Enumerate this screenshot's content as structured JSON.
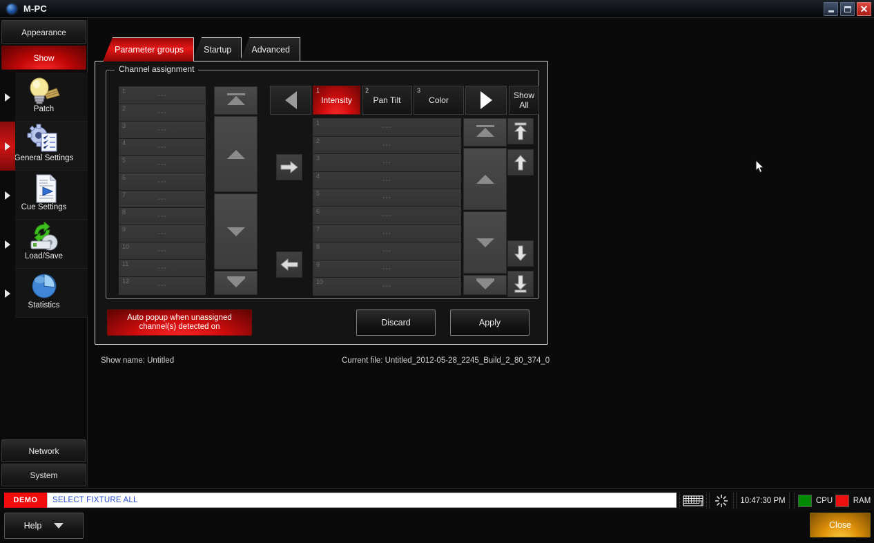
{
  "window": {
    "title": "M-PC",
    "minimize_label": "Minimize",
    "maximize_label": "Maximize",
    "close_label": "Close"
  },
  "sidebar": {
    "top_buttons": [
      {
        "label": "Appearance",
        "active": false
      },
      {
        "label": "Show",
        "active": true
      }
    ],
    "nav_items": [
      {
        "label": "Patch",
        "icon": "lightbulb-icon",
        "selected": false
      },
      {
        "label": "General Settings",
        "icon": "gear-checklist-icon",
        "selected": true
      },
      {
        "label": "Cue Settings",
        "icon": "document-play-icon",
        "selected": false
      },
      {
        "label": "Load/Save",
        "icon": "disk-arrows-icon",
        "selected": false
      },
      {
        "label": "Statistics",
        "icon": "pie-chart-icon",
        "selected": false
      }
    ],
    "bottom_buttons": [
      {
        "label": "Network"
      },
      {
        "label": "System"
      }
    ]
  },
  "tabs": [
    {
      "label": "Parameter groups",
      "active": true
    },
    {
      "label": "Startup",
      "active": false
    },
    {
      "label": "Advanced",
      "active": false
    }
  ],
  "dialog": {
    "groupbox_title": "Channel assignment",
    "left_list": {
      "rows": [
        {
          "index": "1",
          "value": "---"
        },
        {
          "index": "2",
          "value": "---"
        },
        {
          "index": "3",
          "value": "---"
        },
        {
          "index": "4",
          "value": "---"
        },
        {
          "index": "5",
          "value": "---"
        },
        {
          "index": "6",
          "value": "---"
        },
        {
          "index": "7",
          "value": "---"
        },
        {
          "index": "8",
          "value": "---"
        },
        {
          "index": "9",
          "value": "---"
        },
        {
          "index": "10",
          "value": "---"
        },
        {
          "index": "11",
          "value": "---"
        },
        {
          "index": "12",
          "value": "---"
        }
      ]
    },
    "right_list": {
      "rows": [
        {
          "index": "1",
          "value": "---"
        },
        {
          "index": "2",
          "value": "---"
        },
        {
          "index": "3",
          "value": "---"
        },
        {
          "index": "4",
          "value": "---"
        },
        {
          "index": "5",
          "value": "---"
        },
        {
          "index": "6",
          "value": "---"
        },
        {
          "index": "7",
          "value": "---"
        },
        {
          "index": "8",
          "value": "---"
        },
        {
          "index": "9",
          "value": "---"
        },
        {
          "index": "10",
          "value": "---"
        }
      ]
    },
    "parameter_groups": [
      {
        "index": "1",
        "label": "Intensity",
        "active": true
      },
      {
        "index": "2",
        "label": "Pan Tilt",
        "active": false
      },
      {
        "index": "3",
        "label": "Color",
        "active": false
      }
    ],
    "show_all_label": "Show\nAll",
    "show_all_line1": "Show",
    "show_all_line2": "All",
    "auto_popup_line1": "Auto popup when unassigned",
    "auto_popup_line2": "channel(s) detected on",
    "discard_label": "Discard",
    "apply_label": "Apply"
  },
  "footer": {
    "show_name": "Show name: Untitled",
    "current_file": "Current file: Untitled_2012-05-28_2245_Build_2_80_374_0"
  },
  "statusbar": {
    "demo_badge": "DEMO",
    "command_line": "SELECT FIXTURE ALL",
    "keyboard_icon": "keyboard-icon",
    "busy_icon": "starburst-icon",
    "time": "10:47:30 PM",
    "cpu_label": "CPU",
    "cpu_color": "#008a00",
    "ram_label": "RAM",
    "ram_color": "#ef0f0f"
  },
  "bottom": {
    "help_label": "Help",
    "close_label": "Close"
  },
  "colors": {
    "accent_red": "#d00d0d",
    "accent_orange": "#e0920a",
    "panel_bg": "#141414",
    "list_row": "#3a3a3a"
  }
}
